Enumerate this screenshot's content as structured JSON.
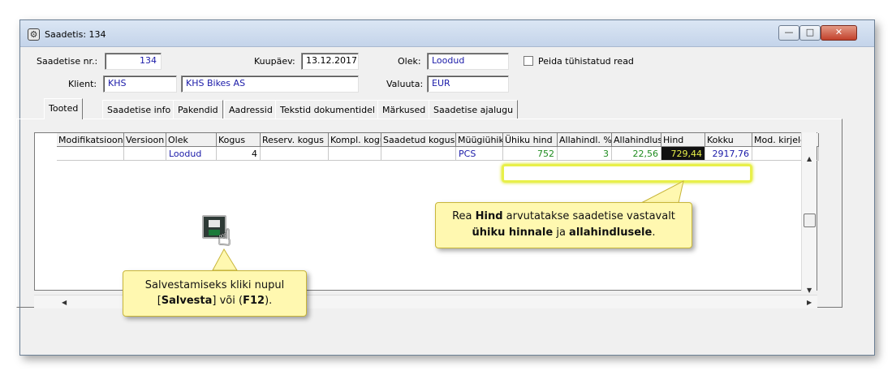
{
  "window": {
    "title": "Saadetis: 134"
  },
  "header": {
    "nr_label": "Saadetise nr.:",
    "nr_value": "134",
    "date_label": "Kuupäev:",
    "date_value": "13.12.2017",
    "state_label": "Olek:",
    "state_value": "Loodud",
    "hide_label": "Peida tühistatud read",
    "client_label": "Klient:",
    "client_code": "KHS",
    "client_name": "KHS Bikes AS",
    "currency_label": "Valuuta:",
    "currency_value": "EUR"
  },
  "tabs": [
    "Tooted",
    "Saadetise info",
    "Pakendid",
    "Aadressid",
    "Tekstid dokumentidel",
    "Märkused",
    "Saadetise ajalugu"
  ],
  "grid": {
    "columns": [
      "Modifikatsioon",
      "Versioon",
      "Olek",
      "Kogus",
      "Reserv. kogus",
      "Kompl. kogus",
      "Saadetud kogus",
      "Müügiühik",
      "Ühiku hind",
      "Allahindl. %",
      "Allahindlus",
      "Hind",
      "Kokku",
      "Mod. kirjeldus"
    ],
    "rows": [
      {
        "modifikatsioon": "",
        "versioon": "",
        "olek": "Loodud",
        "kogus": "4",
        "reserv": "",
        "kompl": "",
        "saadetud": "",
        "muugiuhik": "PCS",
        "uhiku_hind": "752",
        "allahindl_pct": "3",
        "allahindlus": "22,56",
        "hind": "729,44",
        "kokku": "2917,76",
        "mod_kirjeldus": ""
      }
    ]
  },
  "callouts": {
    "price": {
      "p1": "Rea ",
      "b1": "Hind",
      "p2": " arvutatakse saadetise vastavalt",
      "b2": "ühiku hinnale",
      "p3": " ja ",
      "b3": "allahindlusele",
      "p4": "."
    },
    "save": {
      "line1": "Salvestamiseks kliki nupul",
      "p1": "[",
      "b1": "Salvesta",
      "p2": "] või (",
      "b2": "F12",
      "p3": ")."
    }
  },
  "icons": {
    "save": "floppy-disk-icon",
    "cursor": "hand-pointer-icon"
  },
  "colors": {
    "highlight": "#e8f04a",
    "callout_bg": "#fff8b0",
    "link_blue": "#1a1aa8",
    "price_green": "#1f8c1f"
  }
}
